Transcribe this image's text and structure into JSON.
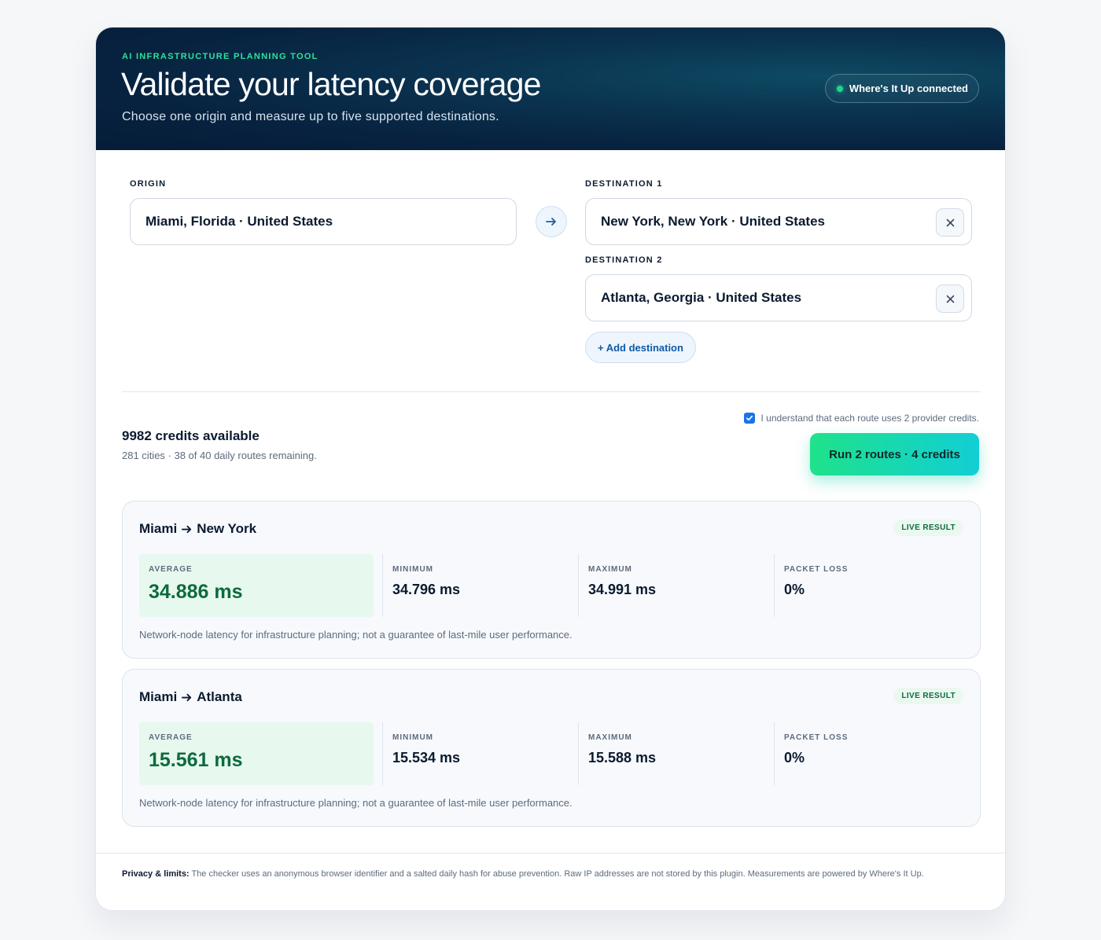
{
  "hero": {
    "eyebrow": "AI INFRASTRUCTURE PLANNING TOOL",
    "title": "Validate your latency coverage",
    "subtitle": "Choose one origin and measure up to five supported destinations.",
    "status": "Where's It Up connected"
  },
  "origin": {
    "label": "ORIGIN",
    "value": "Miami, Florida · United States"
  },
  "destinations": [
    {
      "label": "DESTINATION 1",
      "value": "New York, New York · United States"
    },
    {
      "label": "DESTINATION 2",
      "value": "Atlanta, Georgia · United States"
    }
  ],
  "add_destination": "+ Add destination",
  "credits": {
    "title": "9982 credits available",
    "subtitle": "281 cities · 38 of 40 daily routes remaining."
  },
  "consent": {
    "checked": true,
    "text": "I understand that each route uses 2 provider credits."
  },
  "run_button": "Run 2 routes · 4 credits",
  "results": [
    {
      "origin": "Miami",
      "destination": "New York",
      "badge": "LIVE RESULT",
      "metrics": {
        "average_label": "AVERAGE",
        "average": "34.886 ms",
        "minimum_label": "MINIMUM",
        "minimum": "34.796 ms",
        "maximum_label": "MAXIMUM",
        "maximum": "34.991 ms",
        "loss_label": "PACKET LOSS",
        "loss": "0%"
      },
      "note": "Network-node latency for infrastructure planning; not a guarantee of last-mile user performance."
    },
    {
      "origin": "Miami",
      "destination": "Atlanta",
      "badge": "LIVE RESULT",
      "metrics": {
        "average_label": "AVERAGE",
        "average": "15.561 ms",
        "minimum_label": "MINIMUM",
        "minimum": "15.534 ms",
        "maximum_label": "MAXIMUM",
        "maximum": "15.588 ms",
        "loss_label": "PACKET LOSS",
        "loss": "0%"
      },
      "note": "Network-node latency for infrastructure planning; not a guarantee of last-mile user performance."
    }
  ],
  "footer": {
    "label": "Privacy & limits:",
    "text": "The checker uses an anonymous browser identifier and a salted daily hash for abuse prevention. Raw IP addresses are not stored by this plugin. Measurements are powered by Where's It Up."
  },
  "colors": {
    "accent_green": "#1fd68c",
    "link_blue": "#0f5aa8",
    "hero_navy": "#061c38",
    "result_green": "#0c6b3c"
  },
  "icons": {
    "arrow": "arrow-right-icon",
    "remove": "close-icon",
    "status": "status-dot-icon",
    "check": "check-icon"
  }
}
